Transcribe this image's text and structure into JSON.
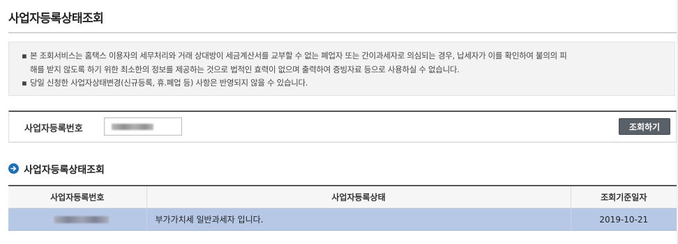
{
  "page": {
    "title": "사업자등록상태조회"
  },
  "notice": {
    "line1": "본 조회서비스는 홈택스 이용자의 세무처리와 거래 상대방이 세금계산서를 교부할 수 없는 폐업자 또는 간이과세자로 의심되는 경우, 납세자가 이를 확인하여 불의의 피",
    "line2": "해를 받지 않도록 하기 위한 최소한의 정보를 제공하는 것으로 법적인 효력이 없으며 출력하여 증빙자료 등으로 사용하실 수 없습니다.",
    "line3": "당일 신청한 사업자상태변경(신규등록, 휴.폐업 등) 사항은 반영되지 않을 수 있습니다.",
    "bullet": "▪"
  },
  "search": {
    "label": "사업자등록번호",
    "input_value": "",
    "button_label": "조회하기"
  },
  "result_section": {
    "title": "사업자등록상태조회",
    "icon": "arrow-right-circle-icon",
    "icon_color": "#1f6fb5"
  },
  "result_table": {
    "headers": [
      "사업자등록번호",
      "사업자등록상태",
      "조회기준일자"
    ],
    "rows": [
      {
        "business_number": "",
        "status": "부가가치세 일반과세자 입니다.",
        "date": "2019-10-21"
      }
    ],
    "row_highlight_color": "#b7c8e6"
  }
}
